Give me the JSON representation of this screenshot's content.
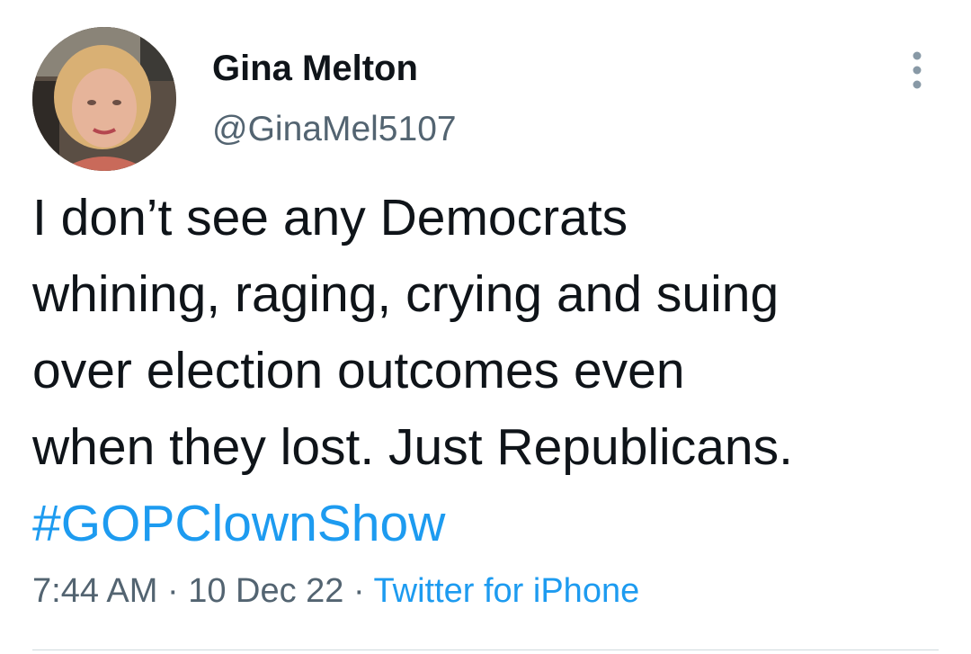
{
  "tweet": {
    "author": {
      "display_name": "Gina Melton",
      "handle": "@GinaMel5107",
      "avatar_icon": "profile-photo"
    },
    "more_icon": "more-vertical-icon",
    "text_lines": [
      "I don’t see any Democrats",
      "whining, raging, crying and suing",
      "over election outcomes even",
      "when they lost. Just Republicans."
    ],
    "hashtag": "#GOPClownShow",
    "time": "7:44 AM",
    "separator": "·",
    "date": "10 Dec 22",
    "source": "Twitter for iPhone",
    "colors": {
      "text": "#0f1419",
      "secondary": "#536471",
      "link": "#1d9bf0",
      "divider": "#cfd9de"
    }
  }
}
